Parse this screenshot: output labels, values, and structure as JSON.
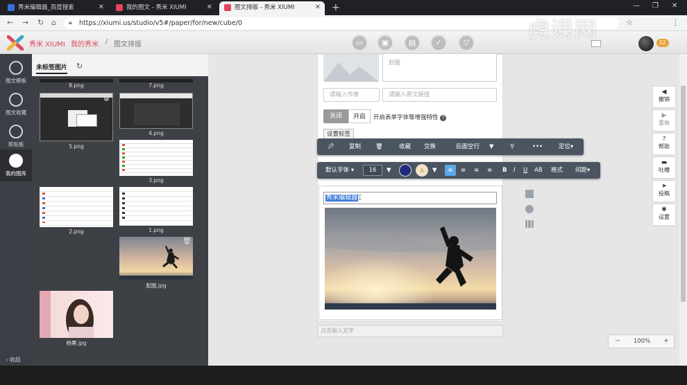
{
  "browser": {
    "tabs": [
      {
        "title": "秀米编辑器_百度搜索"
      },
      {
        "title": "我的图文 - 秀米 XIUMI"
      },
      {
        "title": "图文排版 - 秀米 XIUMI"
      }
    ],
    "url": "https://xiumi.us/studio/v5#/paper/for/new/cube/0"
  },
  "header": {
    "brand": "秀米 XIUMI",
    "breadcrumb": [
      "我的秀米",
      "图文排版"
    ],
    "badge": "12"
  },
  "watermark": "虎课网",
  "leftnav": {
    "items": [
      {
        "label": "图文模板"
      },
      {
        "label": "图文收藏"
      },
      {
        "label": "剪贴板"
      },
      {
        "label": "我的图库"
      }
    ],
    "collapse": "收起"
  },
  "library": {
    "tab": "未标签图片",
    "images": [
      {
        "label": "8.png"
      },
      {
        "label": "7.png"
      },
      {
        "label": "5.png"
      },
      {
        "label": "4.png"
      },
      {
        "label": "3.png"
      },
      {
        "label": "2.png"
      },
      {
        "label": "1.png"
      },
      {
        "label": "配图.jpg"
      },
      {
        "label": "杨幂.jpg"
      }
    ]
  },
  "editor": {
    "cover": "封面",
    "author_placeholder": "请输入作者",
    "link_placeholder": "请输入原文链接",
    "toggle_off": "关闭",
    "toggle_on": "开启",
    "enhance_label": "开启表单字体等增强特性",
    "tags_button": "设置标签",
    "toolbar1": {
      "copy": "复制",
      "favorite": "收藏",
      "swap": "交换",
      "empty_line": "后面空行",
      "more": "•••",
      "position": "定位▾"
    },
    "toolbar2": {
      "font": "默认字体 ▾",
      "size": "16",
      "bold": "B",
      "italic": "I",
      "underline": "U",
      "ab": "AB",
      "format": "格式",
      "spacing": "间距▾"
    },
    "title_text": "秀米编辑器",
    "text_placeholder": "点击输入文字"
  },
  "right_toolbar": [
    {
      "icon": "◀",
      "label": "撤销"
    },
    {
      "icon": "▶",
      "label": "重做"
    },
    {
      "icon": "?",
      "label": "帮助"
    },
    {
      "icon": "▬",
      "label": "吐槽"
    },
    {
      "icon": "➤",
      "label": "投稿"
    },
    {
      "icon": "✱",
      "label": "设置"
    }
  ],
  "zoom": {
    "value": "100%",
    "out": "－",
    "in": "＋"
  },
  "colors": {
    "brand": "#e2455e",
    "toolbar": "#4b5561",
    "selection": "#3a78d8",
    "active_align": "#5aa9e6"
  }
}
